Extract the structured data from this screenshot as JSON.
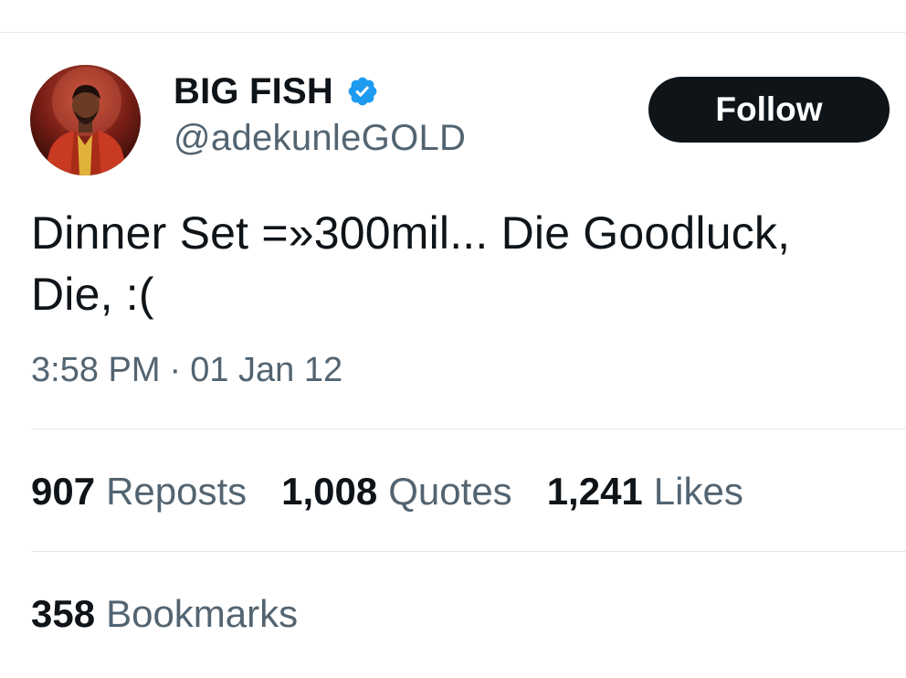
{
  "tweet": {
    "author": {
      "display_name": "BIG FISH",
      "handle": "@adekunleGOLD",
      "verified": true,
      "avatar_icon": "profile-photo",
      "verified_icon": "verified-badge-icon",
      "verified_color": "#1d9bf0"
    },
    "follow_label": "Follow",
    "text_line1": "Dinner Set =»300mil... Die Goodluck,",
    "text_line2": "Die, :(",
    "time": "3:58 PM",
    "separator": "·",
    "date": "01 Jan 12",
    "stats": [
      {
        "value": "907",
        "label": "Reposts"
      },
      {
        "value": "1,008",
        "label": "Quotes"
      },
      {
        "value": "1,241",
        "label": "Likes"
      }
    ],
    "bookmarks": {
      "value": "358",
      "label": "Bookmarks"
    }
  },
  "colors": {
    "text_primary": "#0f1419",
    "text_secondary": "#536471",
    "button_bg": "#0f1419",
    "divider": "#e6e9ec"
  }
}
